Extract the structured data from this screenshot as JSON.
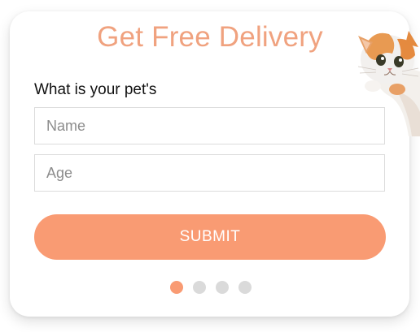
{
  "widget": {
    "title": "Get Free Delivery",
    "prompt": "What is your pet's",
    "fields": {
      "name_placeholder": "Name",
      "age_placeholder": "Age"
    },
    "submit_label": "SUBMIT",
    "pagination": {
      "total": 4,
      "active_index": 0
    }
  },
  "colors": {
    "accent": "#f99b73",
    "title": "#f0a27f",
    "dot_inactive": "#dadada"
  },
  "icons": [
    "cat-image"
  ]
}
